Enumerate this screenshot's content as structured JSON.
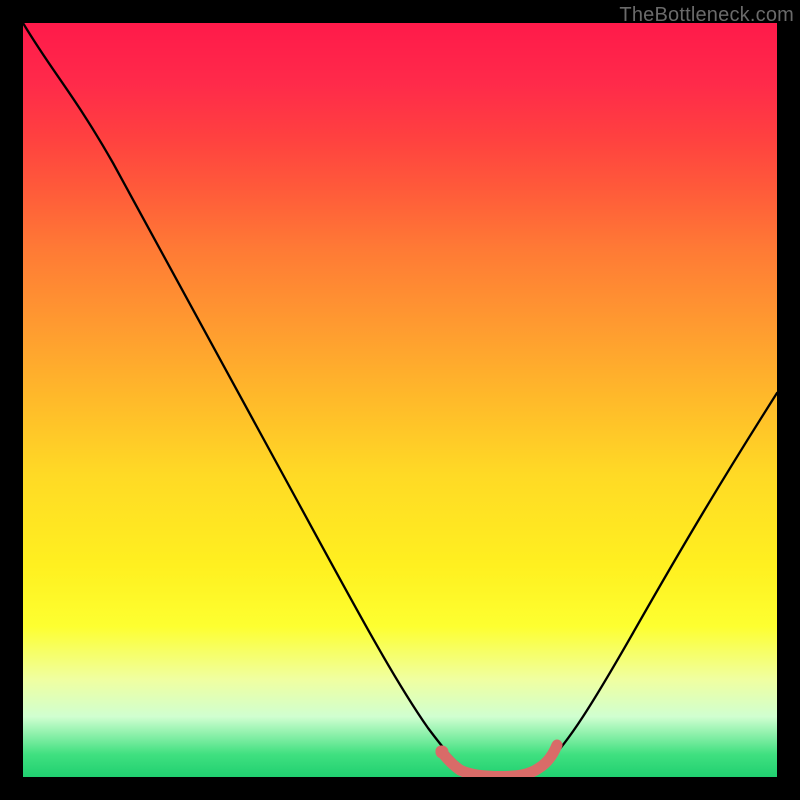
{
  "watermark": "TheBottleneck.com",
  "chart_data": {
    "type": "line",
    "title": "",
    "xlabel": "",
    "ylabel": "",
    "xlim": [
      0,
      100
    ],
    "ylim": [
      0,
      100
    ],
    "series": [
      {
        "name": "bottleneck-curve",
        "x": [
          0,
          4,
          10,
          18,
          26,
          34,
          42,
          50,
          55,
          58,
          62,
          66,
          70,
          76,
          84,
          92,
          100
        ],
        "y": [
          100,
          98,
          90,
          78,
          64,
          50,
          36,
          20,
          8,
          2.5,
          0.5,
          0.5,
          2.5,
          12,
          28,
          44,
          58
        ]
      },
      {
        "name": "highlight-segment",
        "x": [
          55.5,
          56.5,
          58,
          60,
          63,
          66,
          68,
          69.5,
          70.5
        ],
        "y": [
          3.0,
          2.0,
          1.2,
          0.8,
          0.8,
          0.9,
          1.5,
          2.5,
          4.0
        ]
      }
    ],
    "colors": {
      "curve": "#000000",
      "highlight": "#d96b68",
      "gradient_top": "#ff1a4a",
      "gradient_bottom": "#20d070"
    }
  }
}
